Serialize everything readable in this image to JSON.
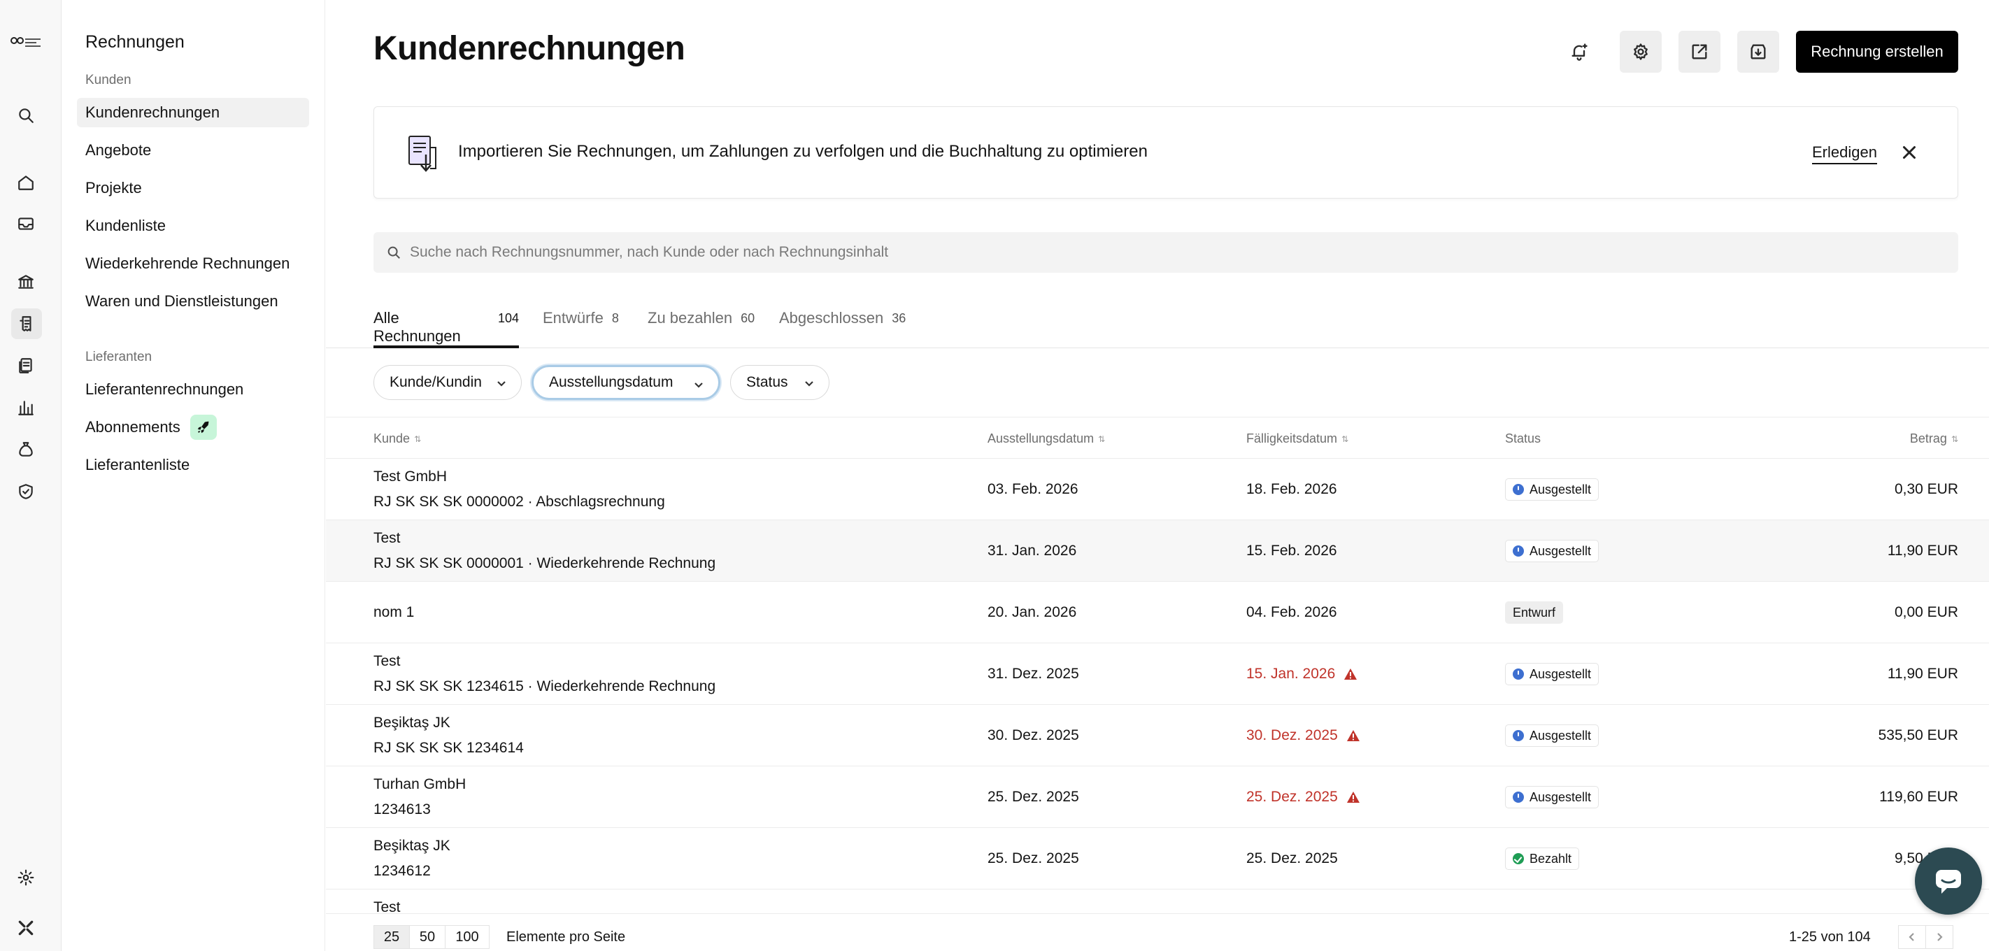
{
  "sidebar": {
    "title": "Rechnungen",
    "section_customers": "Kunden",
    "customer_items": [
      {
        "label": "Kundenrechnungen"
      },
      {
        "label": "Angebote"
      },
      {
        "label": "Projekte"
      },
      {
        "label": "Kundenliste"
      },
      {
        "label": "Wiederkehrende Rechnungen"
      },
      {
        "label": "Waren und Dienstleistungen"
      }
    ],
    "section_suppliers": "Lieferanten",
    "supplier_items": [
      {
        "label": "Lieferantenrechnungen"
      },
      {
        "label": "Abonnements"
      },
      {
        "label": "Lieferantenliste"
      }
    ]
  },
  "header": {
    "title": "Kundenrechnungen",
    "create_label": "Rechnung erstellen"
  },
  "banner": {
    "text": "Importieren Sie Rechnungen, um Zahlungen zu verfolgen und die Buchhaltung zu optimieren",
    "done_label": "Erledigen"
  },
  "search": {
    "placeholder": "Suche nach Rechnungsnummer, nach Kunde oder nach Rechnungsinhalt"
  },
  "tabs": [
    {
      "label": "Alle Rechnungen",
      "count": "104"
    },
    {
      "label": "Entwürfe",
      "count": "8"
    },
    {
      "label": "Zu bezahlen",
      "count": "60"
    },
    {
      "label": "Abgeschlossen",
      "count": "36"
    }
  ],
  "filters": [
    {
      "label": "Kunde/Kundin"
    },
    {
      "label": "Ausstellungsdatum"
    },
    {
      "label": "Status"
    }
  ],
  "table": {
    "columns": {
      "customer": "Kunde",
      "issue_date": "Ausstellungsdatum",
      "due_date": "Fälligkeitsdatum",
      "status": "Status",
      "amount": "Betrag"
    },
    "rows": [
      {
        "customer": "Test GmbH",
        "ref": "RJ SK SK SK 0000002 · Abschlagsrechnung",
        "issue": "03. Feb. 2026",
        "due": "18. Feb. 2026",
        "status": "Ausgestellt",
        "amount": "0,30 EUR"
      },
      {
        "customer": "Test",
        "ref": "RJ SK SK SK 0000001 · Wiederkehrende Rechnung",
        "issue": "31. Jan. 2026",
        "due": "15. Feb. 2026",
        "status": "Ausgestellt",
        "amount": "11,90 EUR"
      },
      {
        "customer": "nom 1",
        "ref": "",
        "issue": "20. Jan. 2026",
        "due": "04. Feb. 2026",
        "status": "Entwurf",
        "amount": "0,00 EUR"
      },
      {
        "customer": "Test",
        "ref": "RJ SK SK SK 1234615 · Wiederkehrende Rechnung",
        "issue": "31. Dez. 2025",
        "due": "15. Jan. 2026",
        "status": "Ausgestellt",
        "amount": "11,90 EUR"
      },
      {
        "customer": "Beşiktaş JK",
        "ref": "RJ SK SK SK 1234614",
        "issue": "30. Dez. 2025",
        "due": "30. Dez. 2025",
        "status": "Ausgestellt",
        "amount": "535,50 EUR"
      },
      {
        "customer": "Turhan GmbH",
        "ref": "1234613",
        "issue": "25. Dez. 2025",
        "due": "25. Dez. 2025",
        "status": "Ausgestellt",
        "amount": "119,60 EUR"
      },
      {
        "customer": "Beşiktaş JK",
        "ref": "1234612",
        "issue": "25. Dez. 2025",
        "due": "25. Dez. 2025",
        "status": "Bezahlt",
        "amount": "9,50 EUR"
      },
      {
        "customer": "Test"
      }
    ]
  },
  "pagination": {
    "sizes": [
      "25",
      "50",
      "100"
    ],
    "per_page_label": "Elemente pro Seite",
    "range": "1-25 von 104"
  },
  "colors": {
    "primary": "#000000",
    "overdue": "#c0332a",
    "issued": "#3d6fd0",
    "paid": "#1f9d55",
    "chat": "#2c4a52"
  },
  "icons": {
    "rail": [
      "search-icon",
      "home-icon",
      "inbox-icon",
      "bank-icon",
      "invoice-icon",
      "documents-icon",
      "chart-icon",
      "moneybag-icon",
      "shield-icon",
      "settings-icon",
      "brand-icon"
    ],
    "header": [
      "bell-sparkle-icon",
      "gear-icon",
      "export-icon",
      "import-icon"
    ]
  }
}
